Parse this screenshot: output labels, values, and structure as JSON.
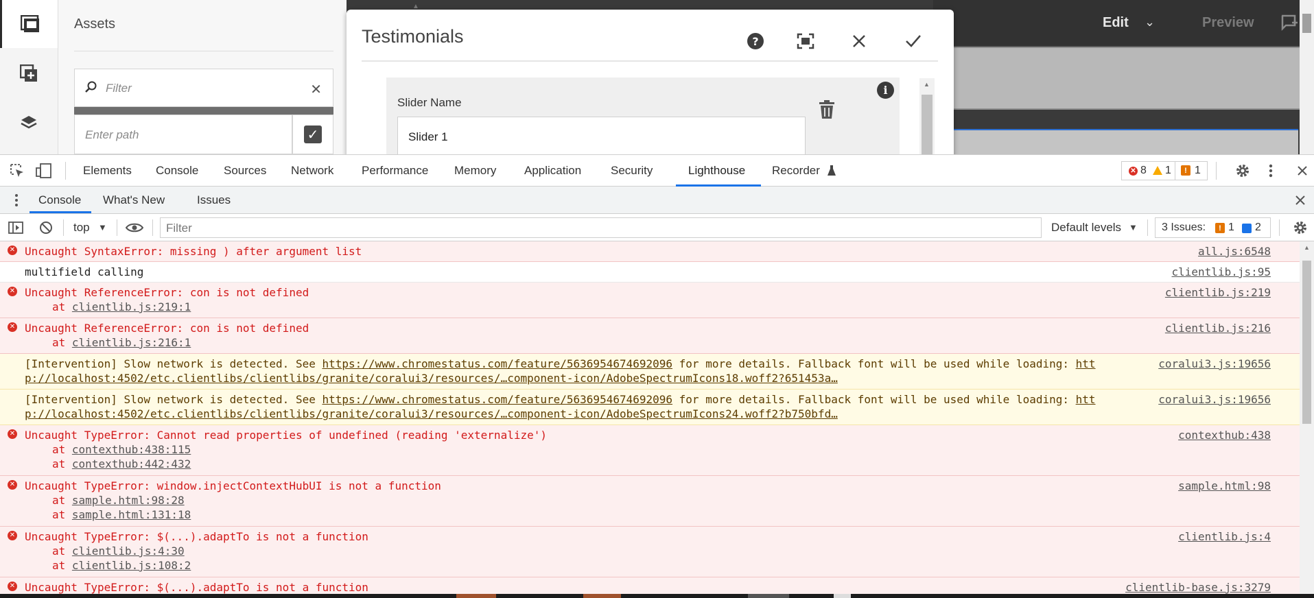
{
  "assets_panel": {
    "title": "Assets",
    "filter_placeholder": "Filter",
    "path_placeholder": "Enter path"
  },
  "editor_header": {
    "edit_label": "Edit",
    "preview_label": "Preview"
  },
  "dialog": {
    "title": "Testimonials",
    "field_label": "Slider Name",
    "field_value": "Slider 1"
  },
  "devtools": {
    "tabs": [
      "Elements",
      "Console",
      "Sources",
      "Network",
      "Performance",
      "Memory",
      "Application",
      "Security",
      "Lighthouse",
      "Recorder"
    ],
    "active_tab": "Lighthouse",
    "counts": {
      "errors": "8",
      "warnings": "1",
      "issues": "1"
    },
    "drawer_tabs": [
      "Console",
      "What's New",
      "Issues"
    ],
    "active_drawer_tab": "Console",
    "context": "top",
    "filter_placeholder": "Filter",
    "levels": "Default levels",
    "issues_summary": {
      "label": "3 Issues:",
      "warn_count": "1",
      "info_count": "2"
    }
  },
  "messages": [
    {
      "type": "error",
      "text": "Uncaught SyntaxError: missing ) after argument list",
      "source": "all.js:6548"
    },
    {
      "type": "log",
      "text": "multifield calling",
      "source": "clientlib.js:95"
    },
    {
      "type": "error",
      "text": "Uncaught ReferenceError: con is not defined",
      "source": "clientlib.js:219",
      "stack": [
        {
          "prefix": "at ",
          "link": "clientlib.js:219:1"
        }
      ]
    },
    {
      "type": "error",
      "text": "Uncaught ReferenceError: con is not defined",
      "source": "clientlib.js:216",
      "stack": [
        {
          "prefix": "at ",
          "link": "clientlib.js:216:1"
        }
      ]
    },
    {
      "type": "warn",
      "text_before": "[Intervention] Slow network is detected. See ",
      "link": "https://www.chromestatus.com/feature/5636954674692096",
      "text_after": " for more details. Fallback font will be used while loading: ",
      "link2_start": "htt",
      "line2": "p://localhost:4502/etc.clientlibs/clientlibs/granite/coralui3/resources/…component-icon/AdobeSpectrumIcons18.woff2?651453a…",
      "source": "coralui3.js:19656"
    },
    {
      "type": "warn",
      "text_before": "[Intervention] Slow network is detected. See ",
      "link": "https://www.chromestatus.com/feature/5636954674692096",
      "text_after": " for more details. Fallback font will be used while loading: ",
      "link2_start": "htt",
      "line2": "p://localhost:4502/etc.clientlibs/clientlibs/granite/coralui3/resources/…component-icon/AdobeSpectrumIcons24.woff2?b750bfd…",
      "source": "coralui3.js:19656"
    },
    {
      "type": "error",
      "text": "Uncaught TypeError: Cannot read properties of undefined (reading 'externalize')",
      "source": "contexthub:438",
      "stack": [
        {
          "prefix": "at ",
          "link": "contexthub:438:115"
        },
        {
          "prefix": "at ",
          "link": "contexthub:442:432"
        }
      ]
    },
    {
      "type": "error",
      "text": "Uncaught TypeError: window.injectContextHubUI is not a function",
      "source": "sample.html:98",
      "stack": [
        {
          "prefix": "at ",
          "link": "sample.html:98:28"
        },
        {
          "prefix": "at ",
          "link": "sample.html:131:18"
        }
      ]
    },
    {
      "type": "error",
      "text": "Uncaught TypeError: $(...).adaptTo is not a function",
      "source": "clientlib.js:4",
      "stack": [
        {
          "prefix": "at ",
          "link": "clientlib.js:4:30"
        },
        {
          "prefix": "at ",
          "link": "clientlib.js:108:2"
        }
      ]
    },
    {
      "type": "error",
      "text": "Uncaught TypeError: $(...).adaptTo is not a function",
      "source": "clientlib-base.js:3279"
    }
  ],
  "colors": {
    "accent": "#1a73e8",
    "error": "#d93025",
    "warning": "#f9ab00"
  }
}
